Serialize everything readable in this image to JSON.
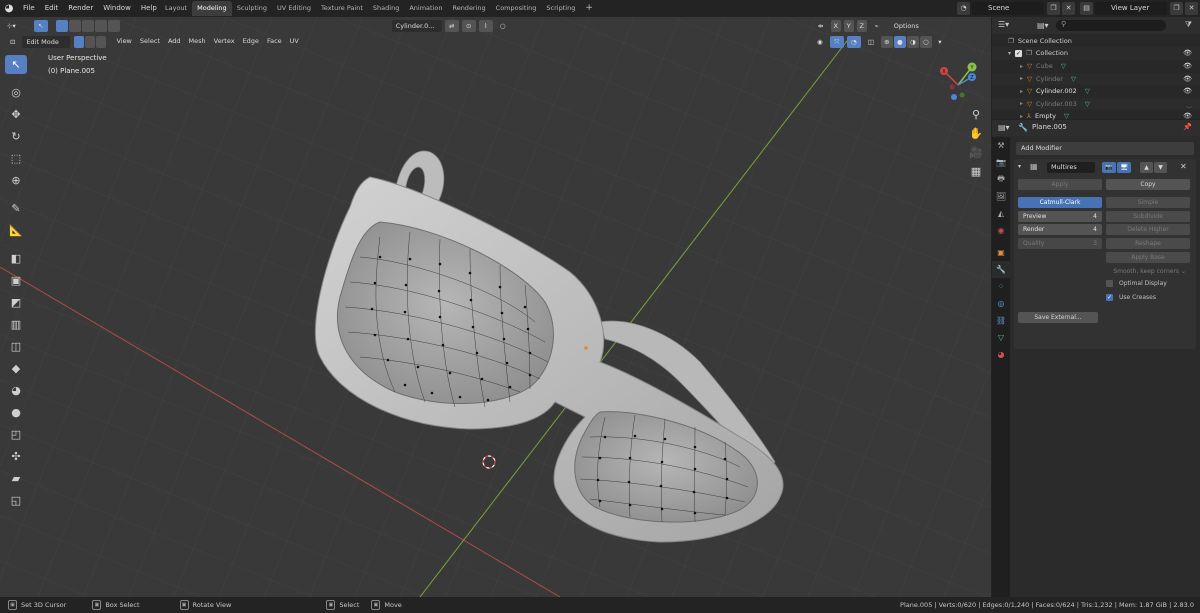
{
  "app": {
    "menu": [
      "File",
      "Edit",
      "Render",
      "Window",
      "Help"
    ],
    "workspaces": [
      "Layout",
      "Modeling",
      "Sculpting",
      "UV Editing",
      "Texture Paint",
      "Shading",
      "Animation",
      "Rendering",
      "Compositing",
      "Scripting"
    ],
    "active_workspace": "Modeling",
    "scene": "Scene",
    "view_layer": "View Layer"
  },
  "viewport": {
    "mode": "Edit Mode",
    "menus": [
      "View",
      "Select",
      "Add",
      "Mesh",
      "Vertex",
      "Edge",
      "Face",
      "UV"
    ],
    "active_object_field": "Cylinder.0...",
    "options_label": "Options",
    "axis_labels": [
      "X",
      "Y",
      "Z"
    ],
    "perspective_label": "User Perspective",
    "object_label": "(0) Plane.005",
    "gizmo": {
      "x": "X",
      "y": "Y",
      "z": "Z"
    }
  },
  "tools": [
    {
      "name": "select-box-tool",
      "icon": "↖",
      "active": true
    },
    {
      "name": "cursor-tool",
      "icon": "◎"
    },
    {
      "name": "move-tool",
      "icon": "✥"
    },
    {
      "name": "rotate-tool",
      "icon": "↻"
    },
    {
      "name": "scale-tool",
      "icon": "⬚"
    },
    {
      "name": "transform-tool",
      "icon": "⊕"
    },
    {
      "name": "annotate-tool",
      "icon": "✎"
    },
    {
      "name": "measure-tool",
      "icon": "📐"
    },
    {
      "name": "extrude-tool",
      "icon": "◧"
    },
    {
      "name": "inset-tool",
      "icon": "▣"
    },
    {
      "name": "bevel-tool",
      "icon": "◩"
    },
    {
      "name": "loop-cut-tool",
      "icon": "▥"
    },
    {
      "name": "knife-tool",
      "icon": "◫"
    },
    {
      "name": "poly-build-tool",
      "icon": "◆"
    },
    {
      "name": "spin-tool",
      "icon": "◕"
    },
    {
      "name": "smooth-tool",
      "icon": "●"
    },
    {
      "name": "edge-slide-tool",
      "icon": "◰"
    },
    {
      "name": "shrink-fatten-tool",
      "icon": "✣"
    },
    {
      "name": "shear-tool",
      "icon": "▰"
    },
    {
      "name": "rip-tool",
      "icon": "◱"
    }
  ],
  "outliner": {
    "root": "Scene Collection",
    "collection": "Collection",
    "items": [
      {
        "label": "Cube",
        "dim": true,
        "visible": true
      },
      {
        "label": "Cylinder",
        "dim": true,
        "visible": true
      },
      {
        "label": "Cylinder.002",
        "dim": false,
        "visible": true
      },
      {
        "label": "Cylinder.003",
        "dim": true,
        "visible": false
      },
      {
        "label": "Empty",
        "dim": false,
        "visible": true
      }
    ]
  },
  "properties": {
    "object_name": "Plane.005",
    "add_modifier": "Add Modifier",
    "modifier": {
      "name": "Multires",
      "apply": "Apply",
      "copy": "Copy",
      "catmull_clark": "Catmull-Clark",
      "simple": "Simple",
      "preview_label": "Preview",
      "preview_value": "4",
      "subdivide": "Subdivide",
      "render_label": "Render",
      "render_value": "4",
      "delete_higher": "Delete Higher",
      "quality_label": "Quality",
      "quality_value": "3",
      "reshape": "Reshape",
      "apply_base": "Apply Base",
      "smooth_dropdown": "Smooth, keep corners",
      "optimal_display": "Optimal Display",
      "use_creases": "Use Creases",
      "save_external": "Save External..."
    }
  },
  "statusbar": {
    "hints": [
      "Set 3D Cursor",
      "Box Select",
      "Rotate View",
      "Select",
      "Move"
    ],
    "stats": "Plane.005 | Verts:0/620 | Edges:0/1,240 | Faces:0/624 | Tris:1,232 | Mem: 1.87 GiB | 2.83.0"
  }
}
